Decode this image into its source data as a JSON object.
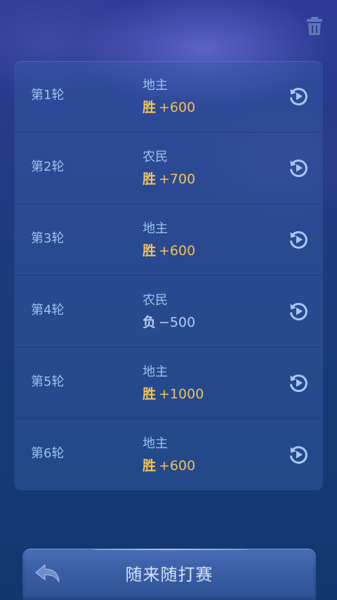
{
  "rounds": [
    {
      "label": "第1轮",
      "role": "地主",
      "result": "胜",
      "score": "+600",
      "outcome": "win"
    },
    {
      "label": "第2轮",
      "role": "农民",
      "result": "胜",
      "score": "+700",
      "outcome": "win"
    },
    {
      "label": "第3轮",
      "role": "地主",
      "result": "胜",
      "score": "+600",
      "outcome": "win"
    },
    {
      "label": "第4轮",
      "role": "农民",
      "result": "负",
      "score": "−500",
      "outcome": "lose"
    },
    {
      "label": "第5轮",
      "role": "地主",
      "result": "胜",
      "score": "+1000",
      "outcome": "win"
    },
    {
      "label": "第6轮",
      "role": "地主",
      "result": "胜",
      "score": "+600",
      "outcome": "win"
    }
  ],
  "bottom_bar": {
    "title": "随来随打赛"
  },
  "icons": {
    "trash": "trash-icon",
    "replay": "replay-icon",
    "back": "back-arrow-icon"
  },
  "colors": {
    "win": "#f0c25a",
    "lose": "#b4cdee",
    "label": "#9cc3f0"
  }
}
